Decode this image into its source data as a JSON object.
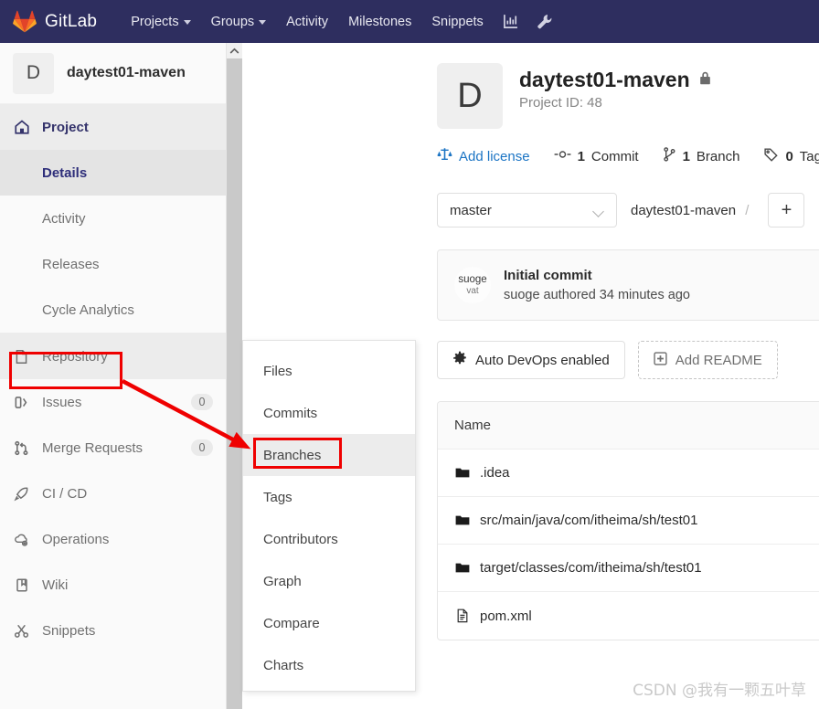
{
  "colors": {
    "navbar_bg": "#2e2e5f",
    "sidebar_bg": "#fafafa",
    "accent_link": "#1b74c4",
    "annotation_red": "#ef0000",
    "active_item": "#34336b",
    "gitlab_orange": "#fc6d26",
    "gitlab_red": "#e24329"
  },
  "navbar": {
    "brand": "GitLab",
    "brand_icon": "gitlab-tanuki-logo",
    "links": [
      {
        "label": "Projects",
        "has_caret": true
      },
      {
        "label": "Groups",
        "has_caret": true
      },
      {
        "label": "Activity",
        "has_caret": false
      },
      {
        "label": "Milestones",
        "has_caret": false
      },
      {
        "label": "Snippets",
        "has_caret": false
      }
    ],
    "icons": [
      {
        "name": "chart-icon"
      },
      {
        "name": "wrench-icon"
      }
    ]
  },
  "sidebar": {
    "project_initial": "D",
    "project_name": "daytest01-maven",
    "items": [
      {
        "label": "Project",
        "icon": "home-icon",
        "type": "top",
        "badge": ""
      },
      {
        "label": "Details",
        "icon": "",
        "type": "sub-active",
        "badge": ""
      },
      {
        "label": "Activity",
        "icon": "",
        "type": "sub",
        "badge": ""
      },
      {
        "label": "Releases",
        "icon": "",
        "type": "sub",
        "badge": ""
      },
      {
        "label": "Cycle Analytics",
        "icon": "",
        "type": "sub",
        "badge": ""
      },
      {
        "label": "Repository",
        "icon": "document-icon",
        "type": "nav-highlight",
        "badge": ""
      },
      {
        "label": "Issues",
        "icon": "issues-icon",
        "type": "nav",
        "badge": "0"
      },
      {
        "label": "Merge Requests",
        "icon": "merge-request-icon",
        "type": "nav",
        "badge": "0"
      },
      {
        "label": "CI / CD",
        "icon": "rocket-icon",
        "type": "nav",
        "badge": ""
      },
      {
        "label": "Operations",
        "icon": "cloud-gear-icon",
        "type": "nav",
        "badge": ""
      },
      {
        "label": "Wiki",
        "icon": "book-icon",
        "type": "nav",
        "badge": ""
      },
      {
        "label": "Snippets",
        "icon": "scissors-icon",
        "type": "nav",
        "badge": ""
      }
    ]
  },
  "flyout": {
    "items": [
      {
        "label": "Files",
        "active": false
      },
      {
        "label": "Commits",
        "active": false
      },
      {
        "label": "Branches",
        "active": true
      },
      {
        "label": "Tags",
        "active": false
      },
      {
        "label": "Contributors",
        "active": false
      },
      {
        "label": "Graph",
        "active": false
      },
      {
        "label": "Compare",
        "active": false
      },
      {
        "label": "Charts",
        "active": false
      }
    ]
  },
  "main": {
    "project_initial": "D",
    "project_title": "daytest01-maven",
    "visibility_icon": "lock-icon",
    "project_id": "Project ID: 48",
    "stats": [
      {
        "label": "Add license",
        "icon": "scale-icon",
        "count": "",
        "is_link": true
      },
      {
        "label": "Commit",
        "icon": "commit-icon",
        "count": "1",
        "is_link": false
      },
      {
        "label": "Branch",
        "icon": "branch-icon",
        "count": "1",
        "is_link": false
      },
      {
        "label": "Tags",
        "icon": "tag-icon",
        "count": "0",
        "is_link": false
      }
    ],
    "branch_selector": {
      "value": "master",
      "icon": "chevron-down-icon"
    },
    "breadcrumb": {
      "repo": "daytest01-maven",
      "separator": "/"
    },
    "add_button_label": "+",
    "commit": {
      "avatar_line1": "suoge",
      "avatar_line2": "vat",
      "title": "Initial commit",
      "subtitle": "suoge authored 34 minutes ago"
    },
    "actions": [
      {
        "label": "Auto DevOps enabled",
        "icon": "gear-icon",
        "style": "solid"
      },
      {
        "label": "Add README",
        "icon": "plus-box-icon",
        "style": "dashed"
      }
    ],
    "files": {
      "header": "Name",
      "rows": [
        {
          "name": ".idea",
          "icon": "folder-icon"
        },
        {
          "name": "src/main/java/com/itheima/sh/test01",
          "icon": "folder-icon"
        },
        {
          "name": "target/classes/com/itheima/sh/test01",
          "icon": "folder-icon"
        },
        {
          "name": "pom.xml",
          "icon": "file-icon"
        }
      ]
    }
  },
  "watermark": "CSDN @我有一颗五叶草"
}
